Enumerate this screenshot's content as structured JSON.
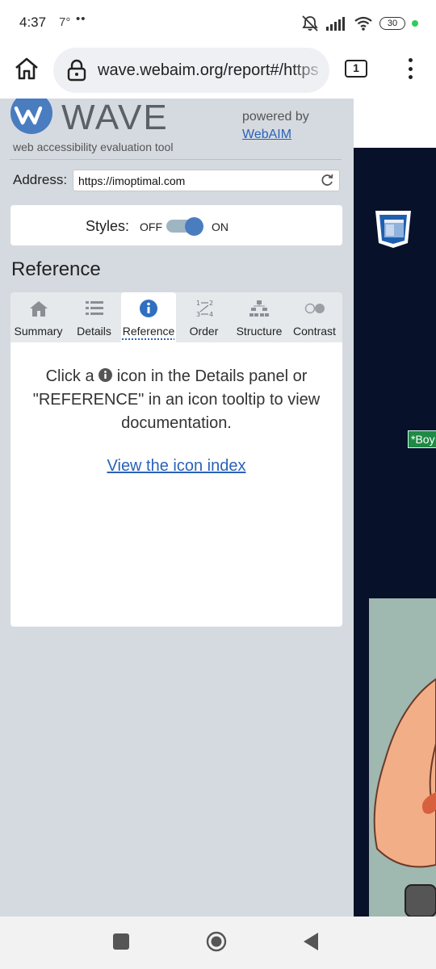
{
  "status_bar": {
    "time": "4:37",
    "temperature": "7°",
    "dots": "••",
    "battery": "30"
  },
  "browser": {
    "url": "wave.webaim.org/report#/https",
    "tab_count": "1"
  },
  "wave": {
    "logo_text": "WAVE",
    "tagline": "web accessibility evaluation tool",
    "powered_by": "powered by",
    "webaim_link": "WebAIM",
    "address_label": "Address:",
    "address_value": "https://imoptimal.com",
    "styles_label": "Styles:",
    "styles_off": "OFF",
    "styles_on": "ON",
    "styles_state": "on",
    "section_title": "Reference",
    "tabs": [
      {
        "label": "Summary",
        "icon": "home-icon"
      },
      {
        "label": "Details",
        "icon": "list-icon"
      },
      {
        "label": "Reference",
        "icon": "info-icon",
        "active": true
      },
      {
        "label": "Order",
        "icon": "order-icon"
      },
      {
        "label": "Structure",
        "icon": "structure-icon"
      },
      {
        "label": "Contrast",
        "icon": "contrast-icon"
      }
    ],
    "reference": {
      "text_before": "Click a",
      "text_after": "icon in the Details panel or \"REFERENCE\" in an icon tooltip to view documentation.",
      "link": "View the icon index"
    }
  },
  "preview": {
    "tag": "*Boy"
  },
  "colors": {
    "panel_bg": "#d5dae0",
    "accent_blue": "#4a7cc0",
    "link_blue": "#2a62b8",
    "preview_bg": "#08112a"
  }
}
